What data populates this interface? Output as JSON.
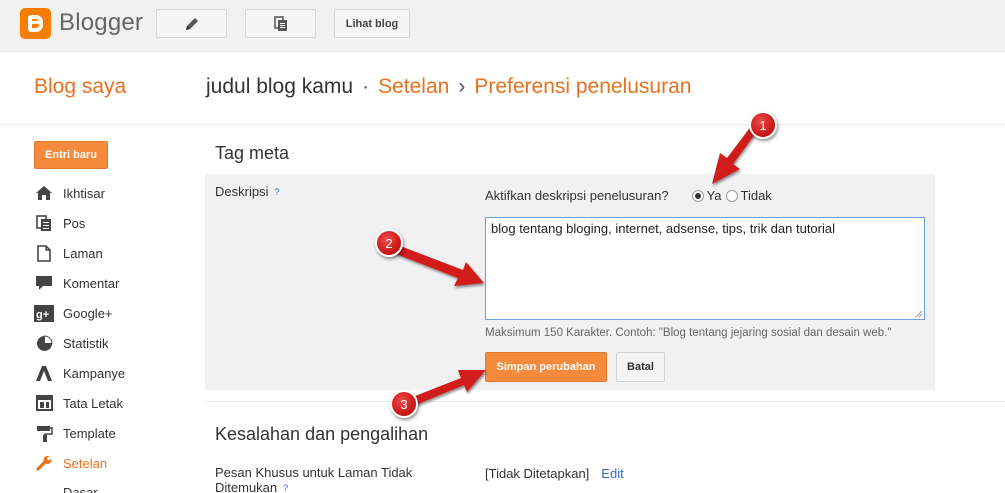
{
  "app": {
    "name": "Blogger",
    "brand_color": "#f57d00",
    "accent_color": "#e8711e"
  },
  "toolbar": {
    "new_post_icon": "pencil-icon",
    "posts_icon": "pages-icon",
    "view_blog_label": "Lihat blog"
  },
  "header": {
    "blogs_label": "Blog saya",
    "blog_name": "judul blog kamu",
    "dot": "·",
    "settings": "Setelan",
    "arrow": "›",
    "current_page": "Preferensi penelusuran"
  },
  "sidebar": {
    "new_post_label": "Entri baru",
    "items": [
      {
        "label": "Ikhtisar",
        "icon": "home-icon"
      },
      {
        "label": "Pos",
        "icon": "posts-icon"
      },
      {
        "label": "Laman",
        "icon": "page-icon"
      },
      {
        "label": "Komentar",
        "icon": "comment-icon"
      },
      {
        "label": "Google+",
        "icon": "google-plus-icon"
      },
      {
        "label": "Statistik",
        "icon": "pie-chart-icon"
      },
      {
        "label": "Kampanye",
        "icon": "campaign-icon"
      },
      {
        "label": "Tata Letak",
        "icon": "layout-icon"
      },
      {
        "label": "Template",
        "icon": "paint-roller-icon"
      },
      {
        "label": "Setelan",
        "icon": "wrench-icon",
        "active": true
      },
      {
        "label": "Dasar"
      }
    ]
  },
  "meta_section": {
    "title": "Tag meta",
    "description_label": "Deskripsi",
    "help": "?",
    "enable_question": "Aktifkan deskripsi penelusuran?",
    "yes_label": "Ya",
    "no_label": "Tidak",
    "selected": "Ya",
    "description_value": "blog tentang bloging, internet, adsense, tips, trik dan tutorial",
    "hint": "Maksimum 150 Karakter. Contoh: \"Blog tentang jejaring sosial dan desain web.\"",
    "save_label": "Simpan perubahan",
    "cancel_label": "Batal"
  },
  "errors_section": {
    "title": "Kesalahan dan pengalihan",
    "not_found_label": "Pesan Khusus untuk Laman Tidak Ditemukan",
    "help": "?",
    "not_found_value": "[Tidak Ditetapkan]",
    "edit_label": "Edit"
  },
  "annotations": {
    "marker_1": "1",
    "marker_2": "2",
    "marker_3": "3",
    "marker_color": "#d21b1b"
  }
}
